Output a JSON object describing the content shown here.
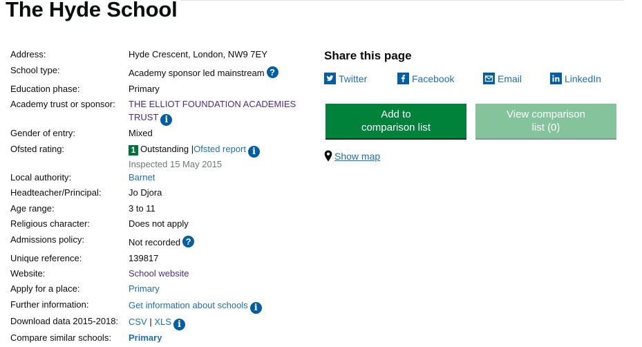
{
  "page": {
    "title": "The Hyde School"
  },
  "details": {
    "address_label": "Address:",
    "address_value": "Hyde Crescent, London, NW9 7EY",
    "school_type_label": "School type:",
    "school_type_value": "Academy sponsor led mainstream",
    "education_phase_label": "Education phase:",
    "education_phase_value": "Primary",
    "sponsor_label": "Academy trust or sponsor:",
    "sponsor_line1": "THE ELLIOT FOUNDATION ACADEMIES",
    "sponsor_line2": "TRUST",
    "gender_label": "Gender of entry:",
    "gender_value": "Mixed",
    "ofsted_label": "Ofsted rating:",
    "ofsted_grade": "1",
    "ofsted_value": "Outstanding",
    "ofsted_sep": "|",
    "ofsted_report": "Ofsted report",
    "ofsted_inspected": "Inspected 15 May 2015",
    "local_authority_label": "Local authority:",
    "local_authority_value": "Barnet",
    "head_label": "Headteacher/Principal:",
    "head_value": "Jo Djora",
    "age_label": "Age range:",
    "age_value": "3 to 11",
    "religious_label": "Religious character:",
    "religious_value": "Does not apply",
    "admissions_label": "Admissions policy:",
    "admissions_value": "Not recorded",
    "urn_label": "Unique reference:",
    "urn_value": "139817",
    "website_label": "Website:",
    "website_value": "School website",
    "apply_label": "Apply for a place:",
    "apply_value": "Primary",
    "further_label": "Further information:",
    "further_value": "Get information about schools",
    "download_label": "Download data 2015-2018:",
    "download_csv": "CSV",
    "download_sep": "|",
    "download_xls": "XLS",
    "compare_label": "Compare similar schools:",
    "compare_value": "Primary"
  },
  "share": {
    "title": "Share this page",
    "twitter": "Twitter",
    "facebook": "Facebook",
    "email": "Email",
    "linkedin": "LinkedIn"
  },
  "buttons": {
    "add_line1": "Add to",
    "add_line2": "comparison list",
    "view_line1": "View comparison",
    "view_line2": "list (0)"
  },
  "map": {
    "label": "Show map"
  },
  "colors": {
    "link": "#1d70b8",
    "visited": "#4c2c92",
    "green_button": "#00823b",
    "disabled_button": "#85c39d",
    "info_icon": "#005ea5"
  }
}
